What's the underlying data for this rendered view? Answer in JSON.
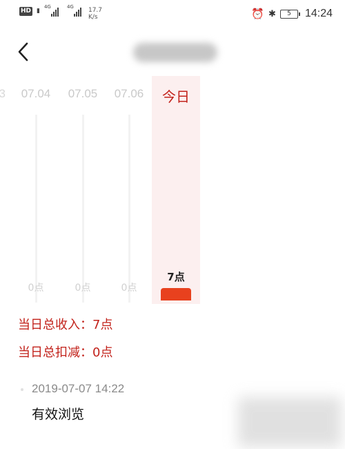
{
  "status_bar": {
    "hd": "HD",
    "sim1_net": "4G",
    "sim2_net": "4G",
    "speed_value": "17.7",
    "speed_unit": "K/s",
    "battery": "5",
    "time": "14:24",
    "icons": [
      "alarm-icon",
      "bluetooth-icon",
      "battery-icon"
    ]
  },
  "nav": {
    "back_icon": "chevron-left-icon"
  },
  "days": [
    {
      "label": "07.04",
      "value": "0点"
    },
    {
      "label": "07.05",
      "value": "0点"
    },
    {
      "label": "07.06",
      "value": "0点"
    },
    {
      "label": "今日",
      "value": "7点",
      "selected": true
    }
  ],
  "summary": {
    "income": "当日总收入：7点",
    "deduction": "当日总扣减：0点"
  },
  "record": {
    "time": "2019-07-07 14:22",
    "desc": "有效浏览"
  },
  "colors": {
    "accent": "#c2221b",
    "bar": "#e8411e",
    "today_bg": "#fcefef"
  }
}
